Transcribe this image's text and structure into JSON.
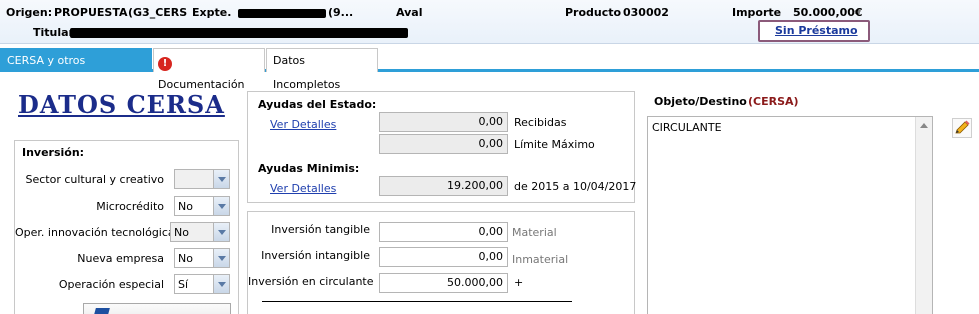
{
  "header": {
    "origen_label": "Origen:",
    "origen_value": "PROPUESTA",
    "origen_code": "(G3_CERS",
    "expte_label": "Expte.",
    "expte_suffix": "(9...",
    "aval_label": "Aval",
    "producto_label": "Producto",
    "producto_value": "030002",
    "importe_label": "Importe",
    "importe_value": "50.000,00€",
    "titular_label": "Titular",
    "sin_prestamo_link": "Sin Préstamo"
  },
  "tabs": [
    {
      "label": "CERSA y otros Reavalistas",
      "active": true
    },
    {
      "label": "Documentación",
      "icon": "warning-icon"
    },
    {
      "label": "Datos Incompletos"
    }
  ],
  "main": {
    "title": "DATOS CERSA",
    "inversion": {
      "heading": "Inversión:",
      "rows": [
        {
          "label": "Sector cultural y creativo",
          "value": "",
          "disabled": true
        },
        {
          "label": "Microcrédito",
          "value": "No",
          "disabled": false
        },
        {
          "label": "Oper. innovación tecnológica",
          "value": "No",
          "disabled": true
        },
        {
          "label": "Nueva empresa",
          "value": "No",
          "disabled": false
        },
        {
          "label": "Operación especial",
          "value": "Sí",
          "disabled": false
        }
      ]
    },
    "ayudas_estado": {
      "heading": "Ayudas del Estado:",
      "link": "Ver Detalles",
      "recibidas_value": "0,00",
      "recibidas_label": "Recibidas",
      "limite_value": "0,00",
      "limite_label": "Límite Máximo"
    },
    "ayudas_minimis": {
      "heading": "Ayudas Minimis:",
      "link": "Ver Detalles",
      "value": "19.200,00",
      "period": "de 2015 a 10/04/2017"
    },
    "inversiones": {
      "tangible_label": "Inversión tangible",
      "tangible_value": "0,00",
      "tangible_note": "Material",
      "intangible_label": "Inversión intangible",
      "intangible_value": "0,00",
      "intangible_note": "Inmaterial",
      "circulante_label": "Inversión en circulante",
      "circulante_value": "50.000,00",
      "circulante_note": "+"
    },
    "objeto": {
      "label": "Objeto/Destino",
      "tag": "(CERSA)",
      "text": "CIRCULANTE"
    }
  },
  "colors": {
    "accent": "#2e9fd8",
    "title": "#1b2c8a",
    "link": "#1f3fae",
    "tag": "#8b1a1a",
    "warning": "#d7261f"
  }
}
